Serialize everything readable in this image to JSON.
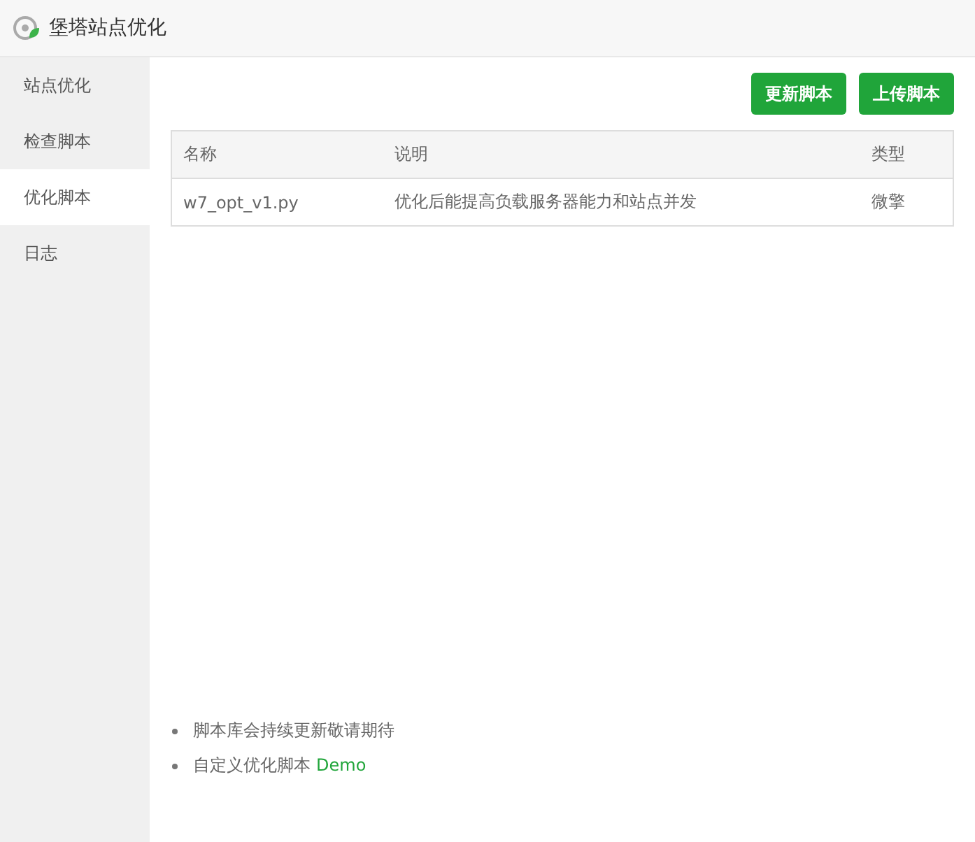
{
  "window": {
    "title": "堡塔站点优化"
  },
  "sidebar": {
    "items": [
      {
        "label": "站点优化",
        "selected": false
      },
      {
        "label": "检查脚本",
        "selected": false
      },
      {
        "label": "优化脚本",
        "selected": true
      },
      {
        "label": "日志",
        "selected": false
      }
    ]
  },
  "buttons": [
    "更新脚本",
    "上传脚本"
  ],
  "table": {
    "columns": [
      "名称",
      "说明",
      "类型"
    ],
    "rows": [
      [
        "w7_opt_v1.py",
        "优化后能提高负载服务器能力和站点并发",
        "微擎"
      ]
    ]
  },
  "notes": [
    {
      "text": "脚本库会持续更新敬请期待"
    },
    {
      "text": "自定义优化脚本",
      "link": "Demo"
    }
  ]
}
